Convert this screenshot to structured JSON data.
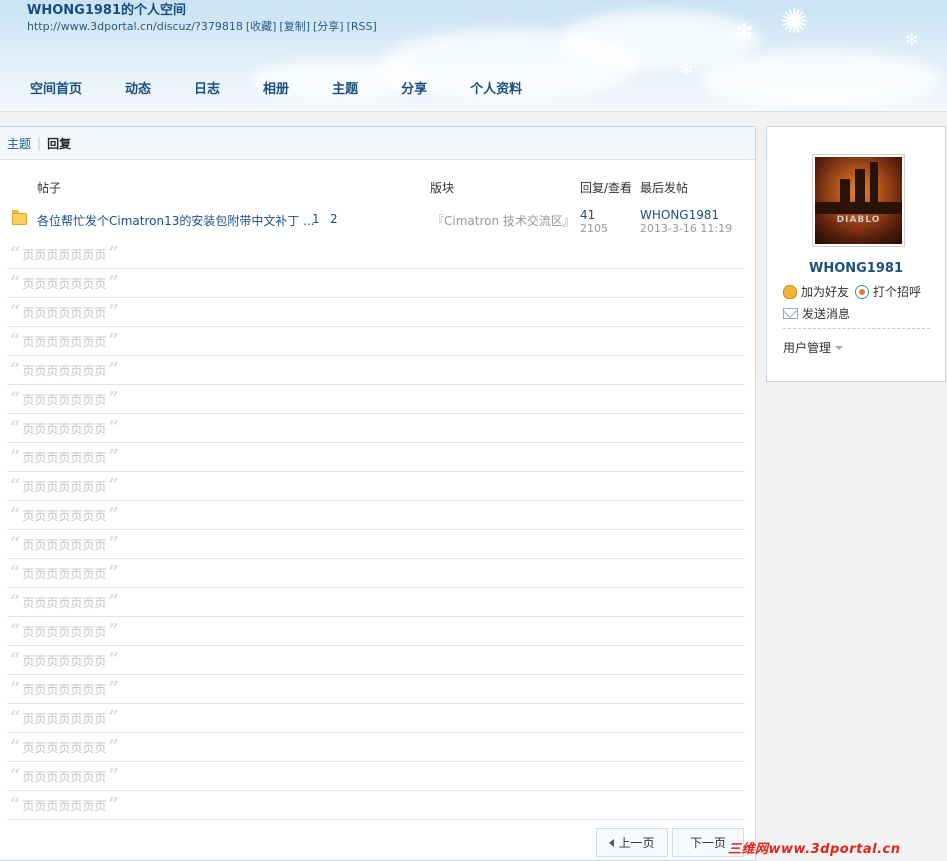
{
  "header": {
    "title": "WHONG1981的个人空间",
    "url": "http://www.3dportal.cn/discuz/?379818",
    "links": [
      "[收藏]",
      "[复制]",
      "[分享]",
      "[RSS]"
    ]
  },
  "nav": [
    "空间首页",
    "动态",
    "日志",
    "相册",
    "主题",
    "分享",
    "个人资料"
  ],
  "tabs": {
    "topics": "主题",
    "replies": "回复"
  },
  "table": {
    "headers": {
      "post": "帖子",
      "forum": "版块",
      "stats": "回复/查看",
      "last": "最后发帖"
    },
    "thread": {
      "title": "各位帮忙发个Cimatron13的安装包附带中文补丁 ...",
      "pages": [
        "1",
        "2"
      ],
      "forum": "『Cimatron 技术交流区』",
      "replies": "41",
      "views": "2105",
      "last_user": "WHONG1981",
      "last_date": "2013-3-16 11:19"
    },
    "placeholder_text": "页页页页页页页",
    "open_quote": "“",
    "close_quote": "”"
  },
  "pager": {
    "prev": "上一页",
    "next": "下一页"
  },
  "sidebar": {
    "avatar_text": "DIABLO",
    "avatar_sub": "III",
    "username": "WHONG1981",
    "add_friend": "加为好友",
    "greet": "打个招呼",
    "message": "发送消息",
    "manage": "用户管理"
  },
  "watermark": "三维网www.3dportal.cn",
  "colors": {
    "link": "#1d4f8a",
    "nav": "#1d4f7e",
    "border": "#c6d8e6",
    "watermark": "#e2231a"
  }
}
